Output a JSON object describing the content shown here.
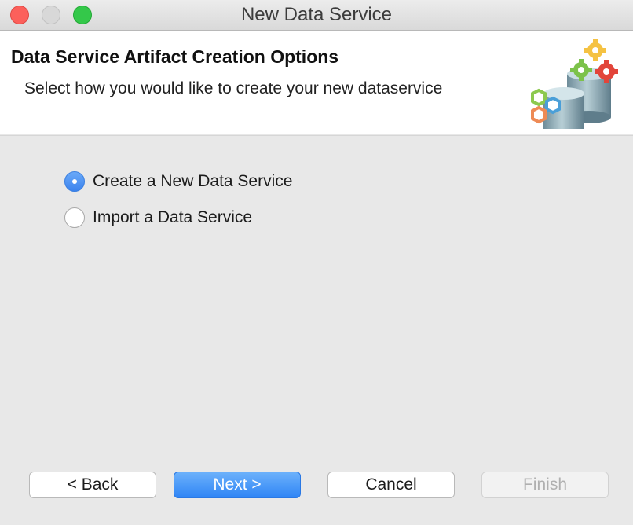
{
  "window": {
    "title": "New Data Service"
  },
  "banner": {
    "title": "Data Service Artifact Creation Options",
    "subtitle": "Select how you would like to create your new dataservice",
    "image_icon": "database-gears-icon"
  },
  "options": [
    {
      "label": "Create a New Data Service",
      "selected": true
    },
    {
      "label": "Import a Data Service",
      "selected": false
    }
  ],
  "buttons": {
    "back": "< Back",
    "next": "Next >",
    "cancel": "Cancel",
    "finish": "Finish"
  },
  "colors": {
    "accent": "#3b83ee",
    "close": "#fc605b",
    "maximize": "#34c84a"
  }
}
